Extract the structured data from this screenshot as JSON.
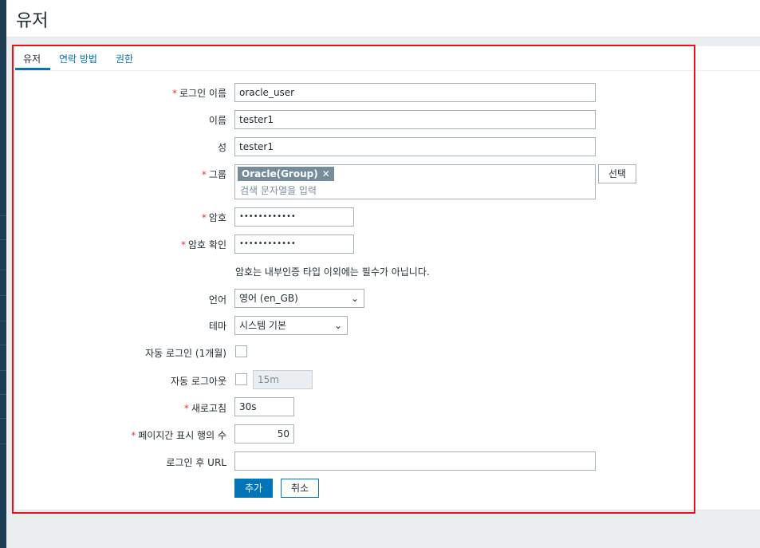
{
  "page": {
    "title": "유저"
  },
  "tabs": [
    {
      "label": "유저"
    },
    {
      "label": "연락 방법"
    },
    {
      "label": "권한"
    }
  ],
  "form": {
    "username": {
      "label": "로그인 이름",
      "value": "oracle_user"
    },
    "name": {
      "label": "이름",
      "value": "tester1"
    },
    "surname": {
      "label": "성",
      "value": "tester1"
    },
    "groups": {
      "label": "그룹",
      "chip": "Oracle(Group)",
      "placeholder": "검색 문자열을 입력",
      "select_button": "선택"
    },
    "password": {
      "label": "암호",
      "value": "••••••••••••"
    },
    "password_confirm": {
      "label": "암호 확인",
      "value": "••••••••••••"
    },
    "password_hint": "암호는 내부인증 타입 이외에는 필수가 아닙니다.",
    "language": {
      "label": "언어",
      "value": "영어 (en_GB)"
    },
    "theme": {
      "label": "테마",
      "value": "시스템 기본"
    },
    "autologin": {
      "label": "자동 로그인 (1개월)",
      "checked": false
    },
    "autologout": {
      "label": "자동 로그아웃",
      "checked": false,
      "value": "15m"
    },
    "refresh": {
      "label": "새로고침",
      "value": "30s"
    },
    "rows_per_page": {
      "label": "페이지간 표시 행의 수",
      "value": "50"
    },
    "url": {
      "label": "로그인 후 URL",
      "value": ""
    },
    "buttons": {
      "add": "추가",
      "cancel": "취소"
    }
  },
  "required_mark": "*",
  "colors": {
    "accent": "#0275b8",
    "required": "#e33734",
    "highlight": "#e8131a",
    "sidebar": "#1c3d52"
  }
}
